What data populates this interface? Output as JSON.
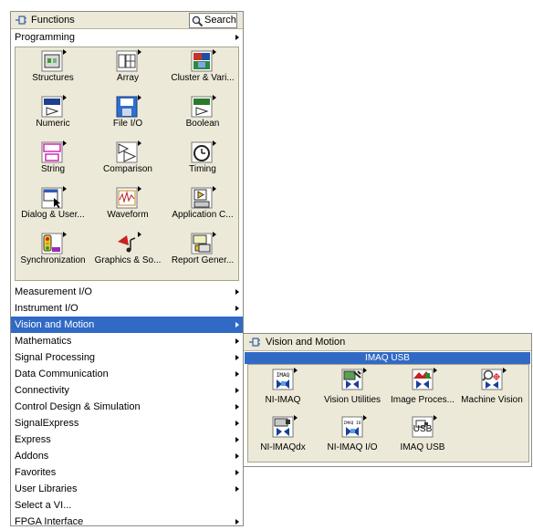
{
  "functions_palette": {
    "title": "Functions",
    "search_label": "Search",
    "programming_label": "Programming",
    "programming_items": [
      {
        "label": "Structures",
        "icon": "structures-icon"
      },
      {
        "label": "Array",
        "icon": "array-icon"
      },
      {
        "label": "Cluster & Vari...",
        "icon": "cluster-icon"
      },
      {
        "label": "Numeric",
        "icon": "numeric-icon"
      },
      {
        "label": "File I/O",
        "icon": "file-io-icon"
      },
      {
        "label": "Boolean",
        "icon": "boolean-icon"
      },
      {
        "label": "String",
        "icon": "string-icon"
      },
      {
        "label": "Comparison",
        "icon": "comparison-icon"
      },
      {
        "label": "Timing",
        "icon": "timing-icon"
      },
      {
        "label": "Dialog & User...",
        "icon": "dialog-icon"
      },
      {
        "label": "Waveform",
        "icon": "waveform-icon"
      },
      {
        "label": "Application C...",
        "icon": "application-control-icon"
      },
      {
        "label": "Synchronization",
        "icon": "synchronization-icon"
      },
      {
        "label": "Graphics & So...",
        "icon": "graphics-sound-icon"
      },
      {
        "label": "Report Gener...",
        "icon": "report-generation-icon"
      }
    ],
    "categories": [
      {
        "label": "Measurement I/O",
        "arrow": true
      },
      {
        "label": "Instrument I/O",
        "arrow": true
      },
      {
        "label": "Vision and Motion",
        "arrow": true
      },
      {
        "label": "Mathematics",
        "arrow": true
      },
      {
        "label": "Signal Processing",
        "arrow": true
      },
      {
        "label": "Data Communication",
        "arrow": true
      },
      {
        "label": "Connectivity",
        "arrow": true
      },
      {
        "label": "Control Design & Simulation",
        "arrow": true
      },
      {
        "label": "SignalExpress",
        "arrow": true
      },
      {
        "label": "Express",
        "arrow": true
      },
      {
        "label": "Addons",
        "arrow": true
      },
      {
        "label": "Favorites",
        "arrow": true
      },
      {
        "label": "User Libraries",
        "arrow": true
      },
      {
        "label": "Select a VI...",
        "arrow": false
      },
      {
        "label": "FPGA Interface",
        "arrow": true
      }
    ],
    "selected_category": "Vision and Motion"
  },
  "vision_submenu": {
    "title": "Vision and Motion",
    "selected_item": "IMAQ USB",
    "items": [
      {
        "label": "NI-IMAQ",
        "icon": "ni-imaq-icon",
        "icon_text": "IMAQ"
      },
      {
        "label": "Vision Utilities",
        "icon": "vision-utilities-icon",
        "icon_text": ""
      },
      {
        "label": "Image Proces...",
        "icon": "image-processing-icon",
        "icon_text": ""
      },
      {
        "label": "Machine Vision",
        "icon": "machine-vision-icon",
        "icon_text": ""
      },
      {
        "label": "NI-IMAQdx",
        "icon": "ni-imaqdx-icon",
        "icon_text": ""
      },
      {
        "label": "NI-IMAQ I/O",
        "icon": "ni-imaq-io-icon",
        "icon_text": "IMAQ IO"
      },
      {
        "label": "IMAQ USB",
        "icon": "imaq-usb-icon",
        "icon_text": "USB"
      }
    ]
  },
  "colors": {
    "selection": "#316ac5",
    "panel": "#ece9d8"
  }
}
